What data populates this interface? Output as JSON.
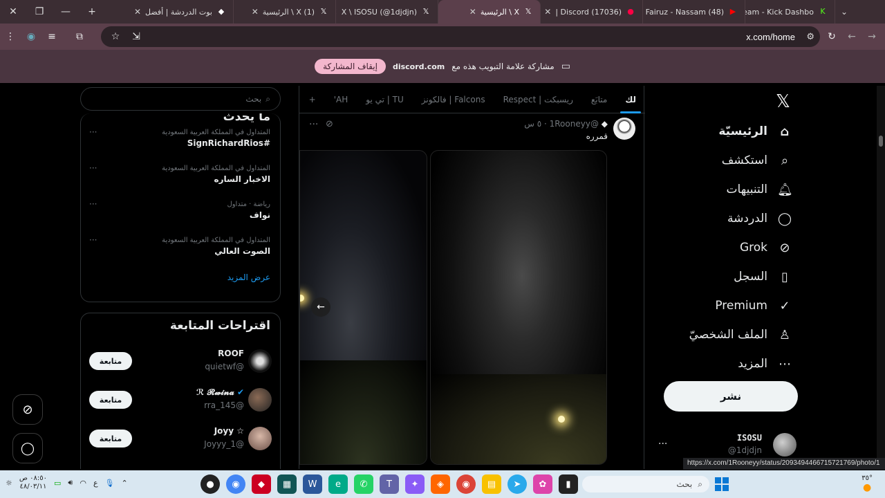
{
  "window_controls": {
    "close": "✕",
    "restore": "❐",
    "minimize": "—",
    "new_tab": "+"
  },
  "tabs": [
    {
      "title": "بوت الدردشة | أفضل",
      "icon": "diamond-icon"
    },
    {
      "title": "(1) X \\ الرئيسية",
      "icon": "x-logo-icon"
    },
    {
      "title": "X \\ ISOSU (@1djdjn)",
      "icon": "x-logo-icon"
    },
    {
      "title": "X \\ الرئيسية",
      "icon": "x-logo-icon",
      "active": true
    },
    {
      "title": "(17036) Discord |",
      "icon": "discord-icon"
    },
    {
      "title": "(48) Fairuz - Nassam",
      "icon": "youtube-icon"
    },
    {
      "title": "Stream - Kick Dashbo",
      "icon": "kick-icon"
    }
  ],
  "address_bar": {
    "url": "x.com/home"
  },
  "share_bar": {
    "stop_label": "إيقاف المشاركة",
    "domain": "discord.com",
    "message": "مشاركة علامة التبويب هذه مع"
  },
  "sidebar": {
    "items": [
      {
        "label": "الرئيسيّة",
        "icon": "home-icon",
        "glyph": "⌂",
        "bold": true
      },
      {
        "label": "استكشف",
        "icon": "search-icon",
        "glyph": "⌕"
      },
      {
        "label": "التنبيهات",
        "icon": "bell-icon",
        "glyph": "♫"
      },
      {
        "label": "الدردشة",
        "icon": "chat-icon",
        "glyph": "◯"
      },
      {
        "label": "Grok",
        "icon": "grok-icon",
        "glyph": "⊘"
      },
      {
        "label": "السجل",
        "icon": "bookmark-icon",
        "glyph": "▯"
      },
      {
        "label": "Premium",
        "icon": "verified-icon",
        "glyph": "✓"
      },
      {
        "label": "الملف الشخصيّ",
        "icon": "profile-icon",
        "glyph": "♙"
      },
      {
        "label": "المزيد",
        "icon": "more-icon",
        "glyph": "⋯"
      }
    ],
    "post_label": "نشر",
    "account": {
      "name": "ISOSU",
      "handle": "@1djdjn"
    }
  },
  "feed": {
    "tabs": [
      "لك",
      "متابَع",
      "ريسبكت | Respect",
      "Falcons | فالكونز",
      "TU | تي يو",
      "AH'"
    ],
    "tweet": {
      "handle": "@1Rooneyy",
      "time": "٥ س",
      "text": "قمرره"
    }
  },
  "right": {
    "search_placeholder": "بحث",
    "trends_title": "ما يحدث",
    "trends": [
      {
        "context": "المتداول في المملكة العربية السعودية",
        "title": "#SignRichardRios"
      },
      {
        "context": "المتداول في المملكة العربية السعودية",
        "title": "الاخبار الساره"
      },
      {
        "context": "رياضة · متداول",
        "title": "نواف"
      },
      {
        "context": "المتداول في المملكة العربية السعودية",
        "title": "الصوت العالي"
      }
    ],
    "show_more": "عرض المزيد",
    "follow_title": "اقتراحات المتابعة",
    "follow_button": "متابعة",
    "suggestions": [
      {
        "name": "ROOF",
        "handle": "@quietwf"
      },
      {
        "name": "ℛ 𝓡𝔀𝓲𝓷𝓪",
        "handle": "@rra_145"
      },
      {
        "name": "☆ Joyy",
        "handle": "@1_Joyyy"
      }
    ]
  },
  "status_url": "https://x.com/1Rooneyy/status/2093494466715721769/photo/1",
  "taskbar": {
    "search_placeholder": "بحث",
    "time": "٠٨:٥٠ ص",
    "date": "٤٨/٠٣/١١",
    "weather": "٣٥°"
  }
}
